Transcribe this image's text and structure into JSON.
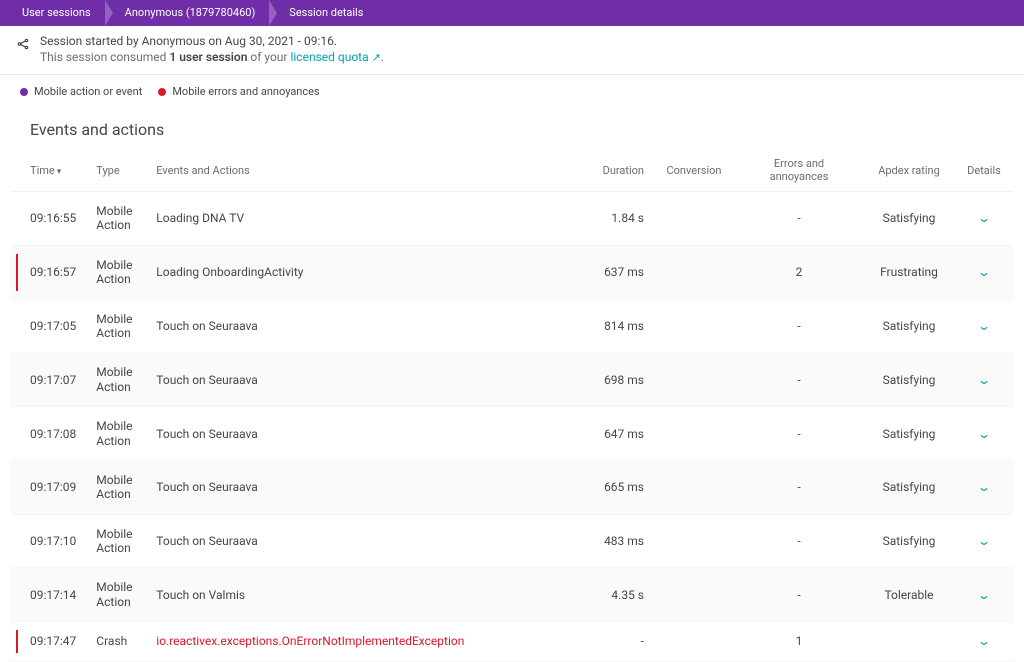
{
  "breadcrumb": {
    "item1": "User sessions",
    "item2": "Anonymous (1879780460)",
    "item3": "Session details"
  },
  "header": {
    "line1": "Session started by Anonymous on Aug 30, 2021 - 09:16.",
    "line2_pre": "This session consumed ",
    "line2_bold": "1 user session",
    "line2_mid": " of your ",
    "link": "licensed quota",
    "ext": "↗"
  },
  "legend": {
    "action": "Mobile action or event",
    "errors": "Mobile errors and annoyances"
  },
  "section_title": "Events and actions",
  "table": {
    "headers": {
      "time": "Time",
      "type": "Type",
      "events": "Events and Actions",
      "duration": "Duration",
      "conversion": "Conversion",
      "errors": "Errors and annoyances",
      "apdex": "Apdex rating",
      "details": "Details"
    },
    "rows": [
      {
        "marker": false,
        "time": "09:16:55",
        "type": "Mobile Action",
        "action": "Loading DNA TV",
        "error_action": false,
        "duration": "1.84 s",
        "conversion": "",
        "errors": "-",
        "errors_hl": false,
        "apdex": "Satisfying",
        "apdex_class": "apdex-satisfying"
      },
      {
        "marker": true,
        "time": "09:16:57",
        "type": "Mobile Action",
        "action": "Loading OnboardingActivity",
        "error_action": false,
        "duration": "637 ms",
        "conversion": "",
        "errors": "2",
        "errors_hl": true,
        "apdex": "Frustrating",
        "apdex_class": "apdex-frustrating"
      },
      {
        "marker": false,
        "time": "09:17:05",
        "type": "Mobile Action",
        "action": "Touch on Seuraava",
        "error_action": false,
        "duration": "814 ms",
        "conversion": "",
        "errors": "-",
        "errors_hl": false,
        "apdex": "Satisfying",
        "apdex_class": "apdex-satisfying"
      },
      {
        "marker": false,
        "time": "09:17:07",
        "type": "Mobile Action",
        "action": "Touch on Seuraava",
        "error_action": false,
        "duration": "698 ms",
        "conversion": "",
        "errors": "-",
        "errors_hl": false,
        "apdex": "Satisfying",
        "apdex_class": "apdex-satisfying"
      },
      {
        "marker": false,
        "time": "09:17:08",
        "type": "Mobile Action",
        "action": "Touch on Seuraava",
        "error_action": false,
        "duration": "647 ms",
        "conversion": "",
        "errors": "-",
        "errors_hl": false,
        "apdex": "Satisfying",
        "apdex_class": "apdex-satisfying"
      },
      {
        "marker": false,
        "time": "09:17:09",
        "type": "Mobile Action",
        "action": "Touch on Seuraava",
        "error_action": false,
        "duration": "665 ms",
        "conversion": "",
        "errors": "-",
        "errors_hl": false,
        "apdex": "Satisfying",
        "apdex_class": "apdex-satisfying"
      },
      {
        "marker": false,
        "time": "09:17:10",
        "type": "Mobile Action",
        "action": "Touch on Seuraava",
        "error_action": false,
        "duration": "483 ms",
        "conversion": "",
        "errors": "-",
        "errors_hl": false,
        "apdex": "Satisfying",
        "apdex_class": "apdex-satisfying"
      },
      {
        "marker": false,
        "time": "09:17:14",
        "type": "Mobile Action",
        "action": "Touch on Valmis",
        "error_action": false,
        "duration": "4.35 s",
        "conversion": "",
        "errors": "-",
        "errors_hl": false,
        "apdex": "Tolerable",
        "apdex_class": "apdex-tolerable"
      },
      {
        "marker": true,
        "time": "09:17:47",
        "type": "Crash",
        "action": "io.reactivex.exceptions.OnErrorNotImplementedException",
        "error_action": true,
        "duration": "-",
        "conversion": "",
        "errors": "1",
        "errors_hl": true,
        "apdex": "",
        "apdex_class": ""
      }
    ]
  }
}
